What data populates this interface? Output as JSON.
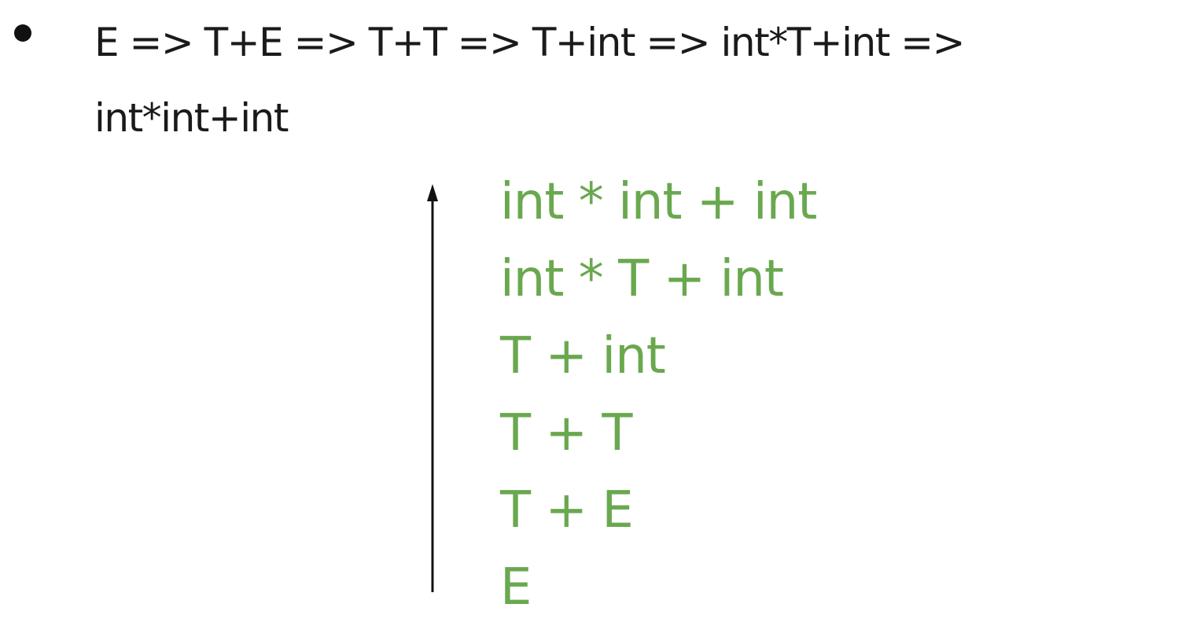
{
  "derivation": {
    "line1": "E => T+E => T+T => T+int => int*T+int =>",
    "line2": "int*int+int"
  },
  "reductions": [
    "int * int + int",
    "int * T + int",
    "T + int",
    "T + T",
    "T + E",
    "E"
  ],
  "colors": {
    "text": "#1a1a1a",
    "reduction": "#6aa84f",
    "arrow": "#111111"
  }
}
